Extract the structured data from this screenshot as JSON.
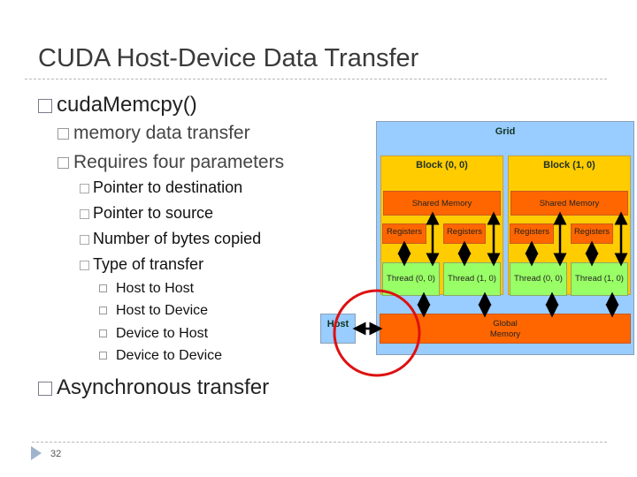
{
  "slide": {
    "title": "CUDA Host-Device Data Transfer",
    "page_number": "32",
    "bullets": {
      "b1": "cudaMemcpy()",
      "b1_1": "memory data transfer",
      "b1_2": "Requires four parameters",
      "params": [
        "Pointer to destination",
        "Pointer to source",
        "Number of bytes copied",
        "Type of transfer"
      ],
      "types": [
        "Host to Host",
        "Host to Device",
        "Device to Host",
        "Device to Device"
      ],
      "b2": "Asynchronous transfer"
    }
  },
  "diagram": {
    "grid_label": "Grid",
    "blocks": [
      {
        "label": "Block (0, 0)",
        "shared": "Shared Memory",
        "registers": [
          "Registers",
          "Registers"
        ],
        "threads": [
          "Thread (0, 0)",
          "Thread (1, 0)"
        ]
      },
      {
        "label": "Block (1, 0)",
        "shared": "Shared Memory",
        "registers": [
          "Registers",
          "Registers"
        ],
        "threads": [
          "Thread (0, 0)",
          "Thread (1, 0)"
        ]
      }
    ],
    "global_memory": [
      "Global",
      "Memory"
    ],
    "host_label": "Host",
    "colors": {
      "grid": "#99ccff",
      "block": "#ffcc00",
      "memory": "#ff6600",
      "thread": "#99ff66",
      "highlight_circle": "#dd1111"
    }
  }
}
